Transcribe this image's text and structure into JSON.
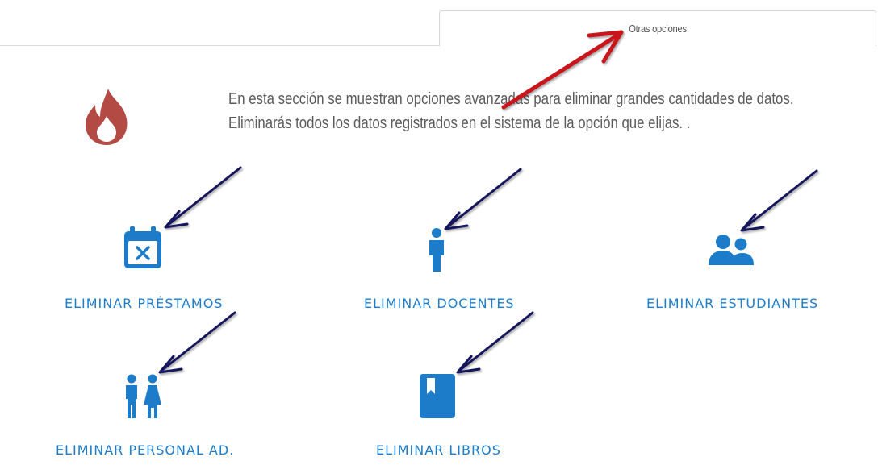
{
  "tab": {
    "label": "Otras opciones"
  },
  "description": "En esta sección se muestran opciones avanzadas para eliminar grandes cantidades de datos. Eliminarás todos los datos registrados en el sistema de la opción que elijas. .",
  "options": [
    {
      "label": "ELIMINAR PRÉSTAMOS",
      "icon": "calendar-x-icon"
    },
    {
      "label": "ELIMINAR DOCENTES",
      "icon": "person-icon"
    },
    {
      "label": "ELIMINAR ESTUDIANTES",
      "icon": "users-icon"
    },
    {
      "label": "ELIMINAR PERSONAL AD.",
      "icon": "restroom-icon"
    },
    {
      "label": "ELIMINAR LIBROS",
      "icon": "book-icon"
    }
  ],
  "colors": {
    "accent": "#1d7cc9",
    "fire": "#b34a43",
    "annotation_red": "#c8161d",
    "annotation_navy": "#14145c"
  }
}
